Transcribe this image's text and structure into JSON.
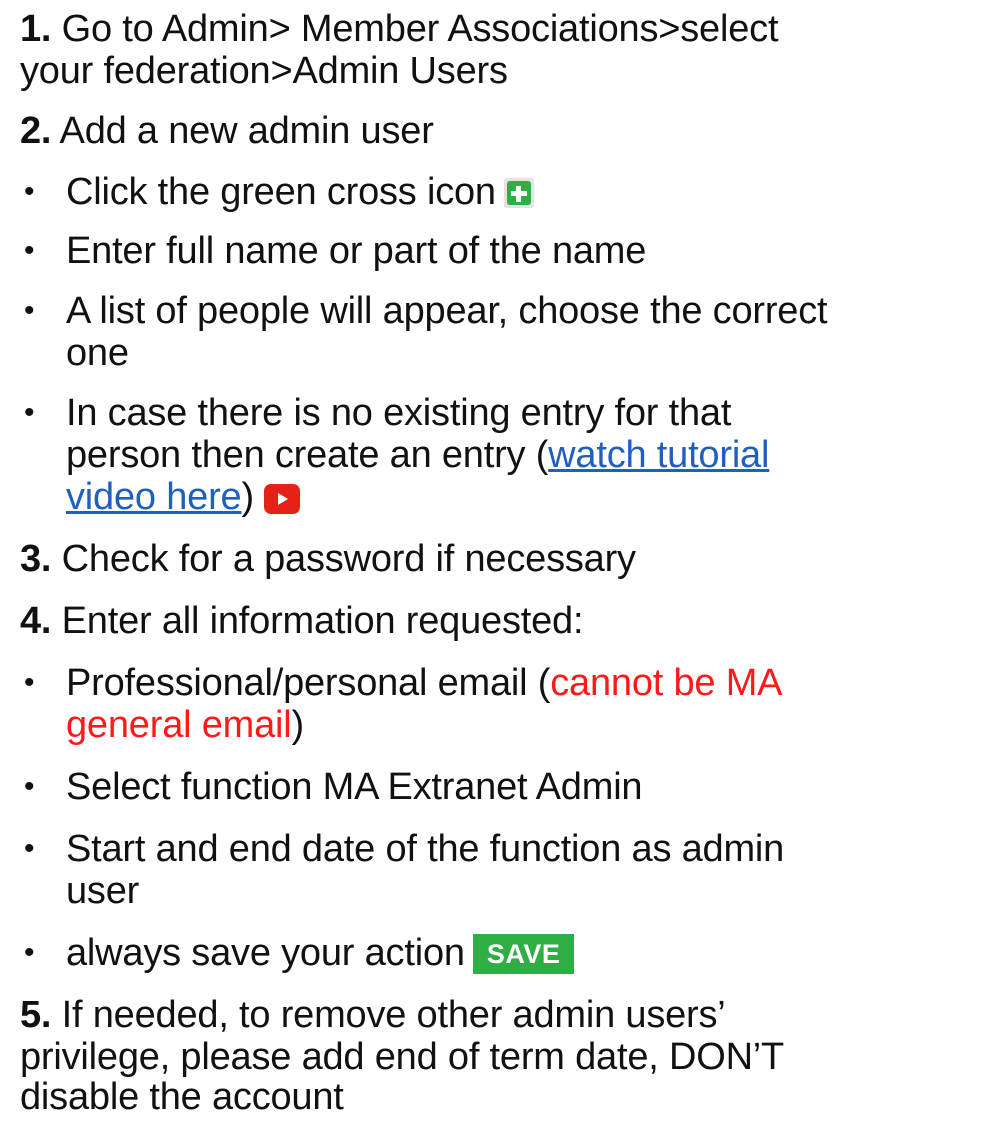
{
  "step1": {
    "num": "1.",
    "text_a": " Go to Admin> Member Associations>select",
    "text_b": "your federation>Admin Users"
  },
  "step2": {
    "num": "2.",
    "text": " Add a new admin user",
    "bullets": {
      "b1": "Click the green cross icon",
      "b2": "Enter full name or part of the name",
      "b3_a": "A list of people will appear, choose the correct",
      "b3_b": "one",
      "b4_a": "In case there is no existing entry for that",
      "b4_b": "person then create an entry (",
      "b4_link_a": "watch tutorial",
      "b4_link_b": "video here",
      "b4_close": ")"
    }
  },
  "step3": {
    "num": "3.",
    "text": " Check for a password if necessary"
  },
  "step4": {
    "num": "4.",
    "text": " Enter all information requested:",
    "bullets": {
      "b1_a": "Professional/personal email (",
      "b1_warn_a": "cannot be MA",
      "b1_warn_b": "general email",
      "b1_close": ")",
      "b2": "Select function MA Extranet Admin",
      "b3_a": "Start and end date of the function as admin",
      "b3_b": "user",
      "b4": "always save your action",
      "save_label": "SAVE"
    }
  },
  "step5": {
    "num": "5.",
    "text_a": " If needed, to remove other admin users’",
    "text_b": "privilege, please add end of term date, DON’T",
    "text_c": "disable the account"
  },
  "bullet_char": "•",
  "colors": {
    "link": "#1f5fbf",
    "warning": "#ff1a1a",
    "add_icon": "#2fae44",
    "play_icon": "#e62117",
    "save_button": "#2fae44"
  },
  "icons": {
    "add": "plus-icon",
    "video": "play-icon"
  }
}
